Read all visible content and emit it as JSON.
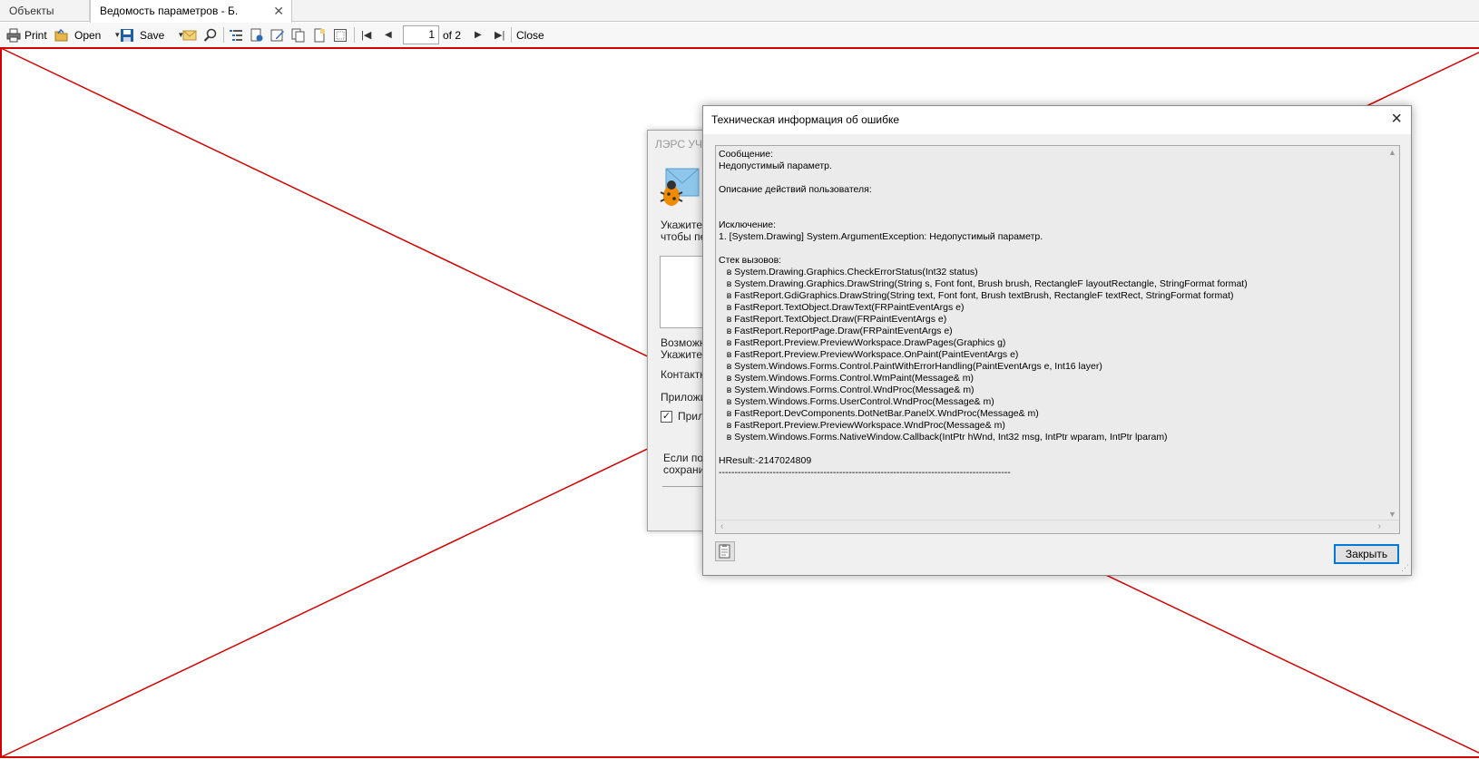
{
  "tabs": [
    {
      "label": "Объекты учета"
    },
    {
      "label": "Ведомость параметров - Б. Зеленин"
    }
  ],
  "toolbar": {
    "print_label": "Print",
    "open_label": "Open",
    "save_label": "Save",
    "page_value": "1",
    "page_of": "of 2",
    "close_label": "Close"
  },
  "bg_dialog": {
    "title": "ЛЭРС УЧЕТ",
    "line1": "Укажите",
    "line2": "чтобы пе",
    "line3": "Возможн",
    "line4": "Укажите",
    "line5": "Контактн",
    "line6": "Приложи",
    "checkbox_label": "Прил",
    "line7": "Если по",
    "line8": "сохрани"
  },
  "error_dialog": {
    "title": "Техническая информация об ошибке",
    "close_icon": "×",
    "text": "Сообщение:\nНедопустимый параметр.\n\nОписание действий пользователя:\n\n\nИсключение:\n1. [System.Drawing] System.ArgumentException: Недопустимый параметр.\n\nСтек вызовов:\n   в System.Drawing.Graphics.CheckErrorStatus(Int32 status)\n   в System.Drawing.Graphics.DrawString(String s, Font font, Brush brush, RectangleF layoutRectangle, StringFormat format)\n   в FastReport.GdiGraphics.DrawString(String text, Font font, Brush textBrush, RectangleF textRect, StringFormat format)\n   в FastReport.TextObject.DrawText(FRPaintEventArgs e)\n   в FastReport.TextObject.Draw(FRPaintEventArgs e)\n   в FastReport.ReportPage.Draw(FRPaintEventArgs e)\n   в FastReport.Preview.PreviewWorkspace.DrawPages(Graphics g)\n   в FastReport.Preview.PreviewWorkspace.OnPaint(PaintEventArgs e)\n   в System.Windows.Forms.Control.PaintWithErrorHandling(PaintEventArgs e, Int16 layer)\n   в System.Windows.Forms.Control.WmPaint(Message& m)\n   в System.Windows.Forms.Control.WndProc(Message& m)\n   в System.Windows.Forms.UserControl.WndProc(Message& m)\n   в FastReport.DevComponents.DotNetBar.PanelX.WndProc(Message& m)\n   в FastReport.Preview.PreviewWorkspace.WndProc(Message& m)\n   в System.Windows.Forms.NativeWindow.Callback(IntPtr hWnd, Int32 msg, IntPtr wparam, IntPtr lparam)\n\nHResult:-2147024809\n--------------------------------------------------------------------------------------------",
    "close_button": "Закрыть"
  },
  "colors": {
    "accent": "#0078d7",
    "page_border": "#d40000"
  }
}
